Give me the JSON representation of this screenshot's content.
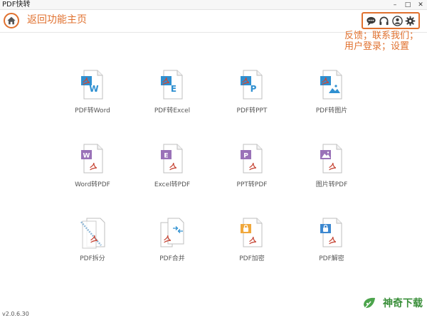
{
  "window": {
    "title": "PDF快转",
    "controls": [
      "minimize",
      "maximize",
      "close"
    ]
  },
  "toolbar": {
    "home_note": "返回功能主页",
    "icons": [
      "chat-icon",
      "headset-icon",
      "user-icon",
      "gear-icon"
    ],
    "note_line1": "反馈；联系我们；",
    "note_line2": "用户登录；设置"
  },
  "tiles": [
    {
      "label": "PDF转Word",
      "letter": "W",
      "color": "#2f90d1",
      "kind": "pdf"
    },
    {
      "label": "PDF转Excel",
      "letter": "E",
      "color": "#2f90d1",
      "kind": "pdf"
    },
    {
      "label": "PDF转PPT",
      "letter": "P",
      "color": "#2f90d1",
      "kind": "pdf"
    },
    {
      "label": "PDF转图片",
      "letter": "",
      "color": "#2f90d1",
      "kind": "pdf-image"
    },
    {
      "label": "Word转PDF",
      "letter": "W",
      "color": "#9a72b8",
      "kind": "to-pdf"
    },
    {
      "label": "Excel转PDF",
      "letter": "E",
      "color": "#9a72b8",
      "kind": "to-pdf"
    },
    {
      "label": "PPT转PDF",
      "letter": "P",
      "color": "#9a72b8",
      "kind": "to-pdf"
    },
    {
      "label": "图片转PDF",
      "letter": "",
      "color": "#9a72b8",
      "kind": "image-to-pdf"
    },
    {
      "label": "PDF拆分",
      "letter": "",
      "color": "#8fb8d8",
      "kind": "split"
    },
    {
      "label": "PDF合并",
      "letter": "",
      "color": "#2f90d1",
      "kind": "merge"
    },
    {
      "label": "PDF加密",
      "letter": "",
      "color": "#f0a83c",
      "kind": "encrypt"
    },
    {
      "label": "PDF解密",
      "letter": "",
      "color": "#3c88d0",
      "kind": "decrypt"
    }
  ],
  "footer": {
    "version": "v2.0.6.30"
  },
  "watermark": {
    "text": "神奇下载"
  },
  "colors": {
    "annotation": "#e0712f",
    "pdf_red": "#c84a3a"
  }
}
